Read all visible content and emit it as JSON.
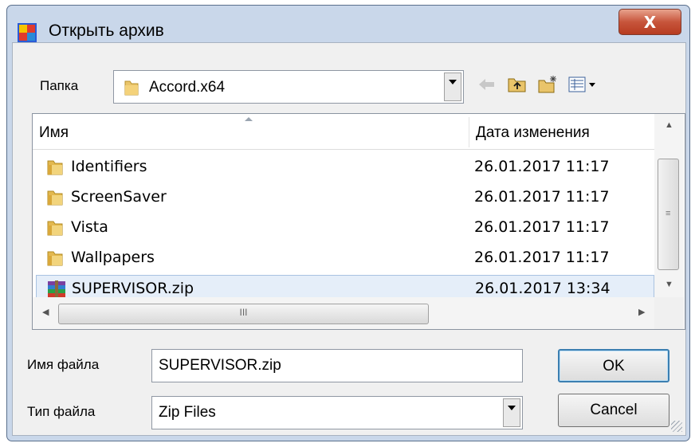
{
  "window": {
    "title": "Открыть архив"
  },
  "folder": {
    "label": "Папка",
    "value": "Accord.x64"
  },
  "toolbar": {
    "icons": [
      "back-arrow-icon",
      "up-folder-icon",
      "new-folder-icon",
      "view-menu-icon"
    ]
  },
  "list": {
    "columns": {
      "name": "Имя",
      "date": "Дата изменения"
    },
    "items": [
      {
        "name": "Identifiers",
        "date": "26.01.2017 11:17",
        "type": "folder"
      },
      {
        "name": "ScreenSaver",
        "date": "26.01.2017 11:17",
        "type": "folder"
      },
      {
        "name": "Vista",
        "date": "26.01.2017 11:17",
        "type": "folder"
      },
      {
        "name": "Wallpapers",
        "date": "26.01.2017 11:17",
        "type": "folder"
      },
      {
        "name": "SUPERVISOR.zip",
        "date": "26.01.2017 13:34",
        "type": "archive",
        "selected": true
      }
    ],
    "hscroll_thumb_glyph": "III",
    "vscroll_thumb_glyph": "≡"
  },
  "filename": {
    "label": "Имя файла",
    "value": "SUPERVISOR.zip"
  },
  "filetype": {
    "label": "Тип файла",
    "value": "Zip Files"
  },
  "buttons": {
    "ok": "OK",
    "cancel": "Cancel",
    "close": "X"
  },
  "colors": {
    "title_bg": "#c9d7ea",
    "selection": "#e5eef9",
    "close_button": "#c7553c"
  }
}
